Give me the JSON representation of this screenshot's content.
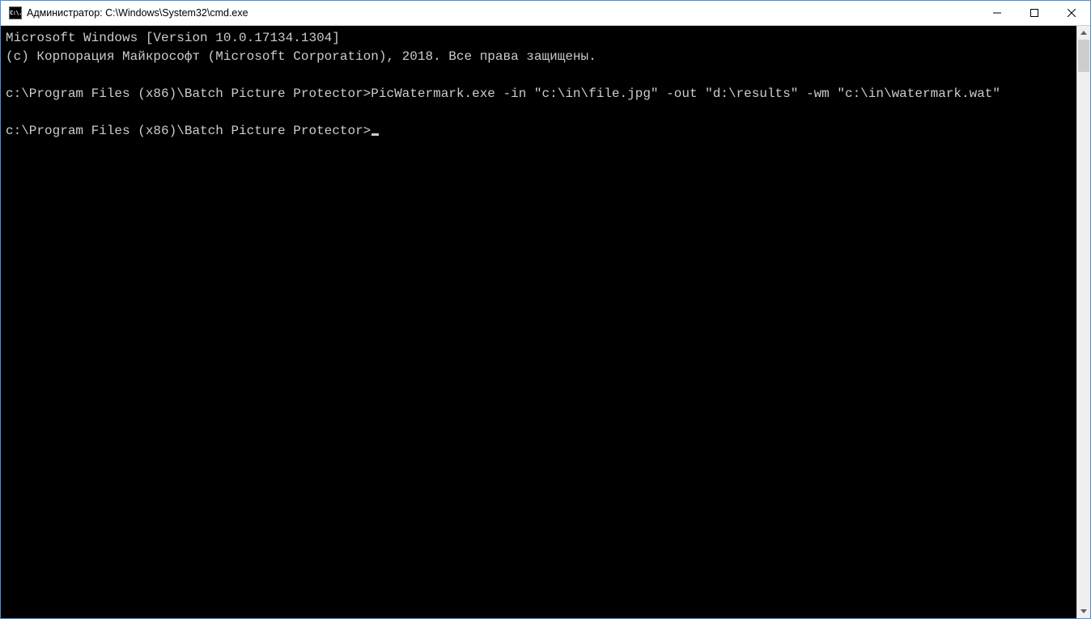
{
  "window": {
    "title": "Администратор: C:\\Windows\\System32\\cmd.exe",
    "icon_label": "C:\\."
  },
  "console": {
    "banner_version": "Microsoft Windows [Version 10.0.17134.1304]",
    "banner_copyright": "(c) Корпорация Майкрософт (Microsoft Corporation), 2018. Все права защищены.",
    "command_line": "c:\\Program Files (x86)\\Batch Picture Protector>PicWatermark.exe -in \"c:\\in\\file.jpg\" -out \"d:\\results\" -wm \"c:\\in\\watermark.wat\"",
    "prompt": "c:\\Program Files (x86)\\Batch Picture Protector>"
  }
}
